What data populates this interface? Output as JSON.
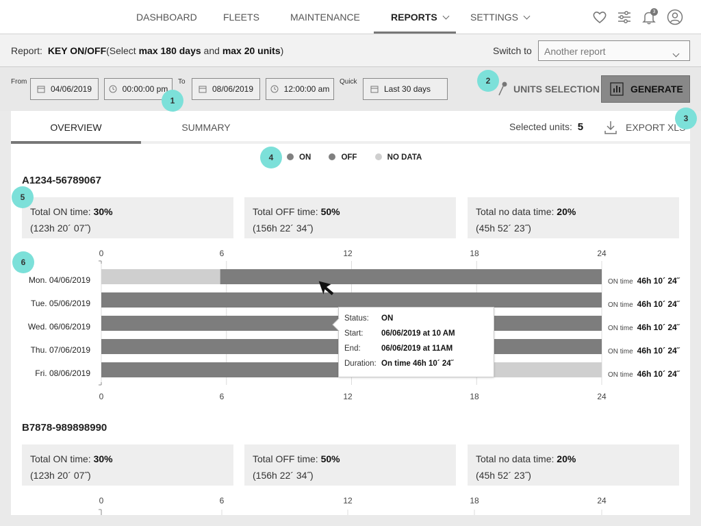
{
  "nav": {
    "items": [
      {
        "label": "DASHBOARD"
      },
      {
        "label": "FLEETS"
      },
      {
        "label": "MAINTENANCE"
      },
      {
        "label": "REPORTS"
      },
      {
        "label": "SETTINGS"
      }
    ],
    "active": "REPORTS",
    "notification_count": "3"
  },
  "report": {
    "label": "Report:",
    "name": "KEY ON/OFF",
    "hint_pre": "(Select ",
    "hint_days": "max 180 days",
    "hint_mid": " and ",
    "hint_units": "max 20 units",
    "hint_post": ")",
    "switch_label": "Switch to",
    "switch_placeholder": "Another report"
  },
  "filters": {
    "from_label": "From",
    "from_date": "04/06/2019",
    "from_time": "00:00:00 pm",
    "to_label": "To",
    "to_date": "08/06/2019",
    "to_time": "12:00:00 am",
    "quick_label": "Quick",
    "quick_value": "Last 30 days",
    "units_selection": "UNITS SELECTION",
    "generate": "GENERATE"
  },
  "badges": [
    "1",
    "2",
    "3",
    "4",
    "5",
    "6"
  ],
  "tabs": [
    {
      "label": "OVERVIEW"
    },
    {
      "label": "SUMMARY"
    }
  ],
  "selected_units_label": "Selected units:",
  "selected_units_count": "5",
  "export_label": "EXPORT XLS",
  "legend": [
    {
      "label": "ON",
      "color": "#808080"
    },
    {
      "label": "OFF",
      "color": "#808080"
    },
    {
      "label": "NO DATA",
      "color": "#cfcfcf"
    }
  ],
  "colors": {
    "on": "#7d7d7d",
    "off": "#7d7d7d",
    "no_data": "#cfcfcf",
    "accent_badge": "#7ce0d9"
  },
  "units": [
    {
      "id": "A1234-56789067",
      "stats": [
        {
          "label": "Total ON time: ",
          "percent": "30%",
          "duration": "(123h 20´ 07˝)"
        },
        {
          "label": "Total OFF time: ",
          "percent": "50%",
          "duration": "(156h 22´ 34˝)"
        },
        {
          "label": "Total no data time: ",
          "percent": "20%",
          "duration": "(45h 52´ 23˝)"
        }
      ],
      "axis_ticks": [
        "0",
        "6",
        "12",
        "18",
        "24"
      ]
    },
    {
      "id": "B7878-989898990",
      "stats": [
        {
          "label": "Total ON time: ",
          "percent": "30%",
          "duration": "(123h 20´ 07˝)"
        },
        {
          "label": "Total OFF time: ",
          "percent": "50%",
          "duration": "(156h 22´ 34˝)"
        },
        {
          "label": "Total no data time: ",
          "percent": "20%",
          "duration": "(45h 52´ 23˝)"
        }
      ],
      "axis_ticks": [
        "0",
        "6",
        "12",
        "18",
        "24"
      ]
    }
  ],
  "chart_data": {
    "type": "timeline",
    "x_range_hours": [
      0,
      24
    ],
    "x_ticks": [
      0,
      6,
      12,
      18,
      24
    ],
    "rows": [
      {
        "day": "Mon. 04/06/2019",
        "on_time_label": "ON time",
        "on_time": "46h 10´ 24˝",
        "segments": [
          {
            "start": 0,
            "end": 5.7,
            "status": "no_data"
          },
          {
            "start": 5.7,
            "end": 24,
            "status": "on"
          }
        ]
      },
      {
        "day": "Tue. 05/06/2019",
        "on_time_label": "ON time",
        "on_time": "46h 10´ 24˝",
        "segments": [
          {
            "start": 0,
            "end": 24,
            "status": "on"
          }
        ]
      },
      {
        "day": "Wed.  06/06/2019",
        "on_time_label": "ON time",
        "on_time": "46h 10´ 24˝",
        "segments": [
          {
            "start": 0,
            "end": 24,
            "status": "on"
          }
        ]
      },
      {
        "day": "Thu. 07/06/2019",
        "on_time_label": "ON time",
        "on_time": "46h 10´ 24˝",
        "segments": [
          {
            "start": 0,
            "end": 24,
            "status": "on"
          }
        ]
      },
      {
        "day": "Fri. 08/06/2019",
        "on_time_label": "ON time",
        "on_time": "46h 10´ 24˝",
        "segments": [
          {
            "start": 0,
            "end": 18.2,
            "status": "on"
          },
          {
            "start": 18.2,
            "end": 24,
            "status": "no_data"
          }
        ]
      }
    ]
  },
  "tooltip": {
    "status_label": "Status:",
    "status": "ON",
    "start_label": "Start:",
    "start": "06/06/2019 at 10 AM",
    "end_label": "End:",
    "end": "06/06/2019 at 11AM",
    "duration_label": "Duration:",
    "duration": "On time  46h 10´ 24˝"
  }
}
